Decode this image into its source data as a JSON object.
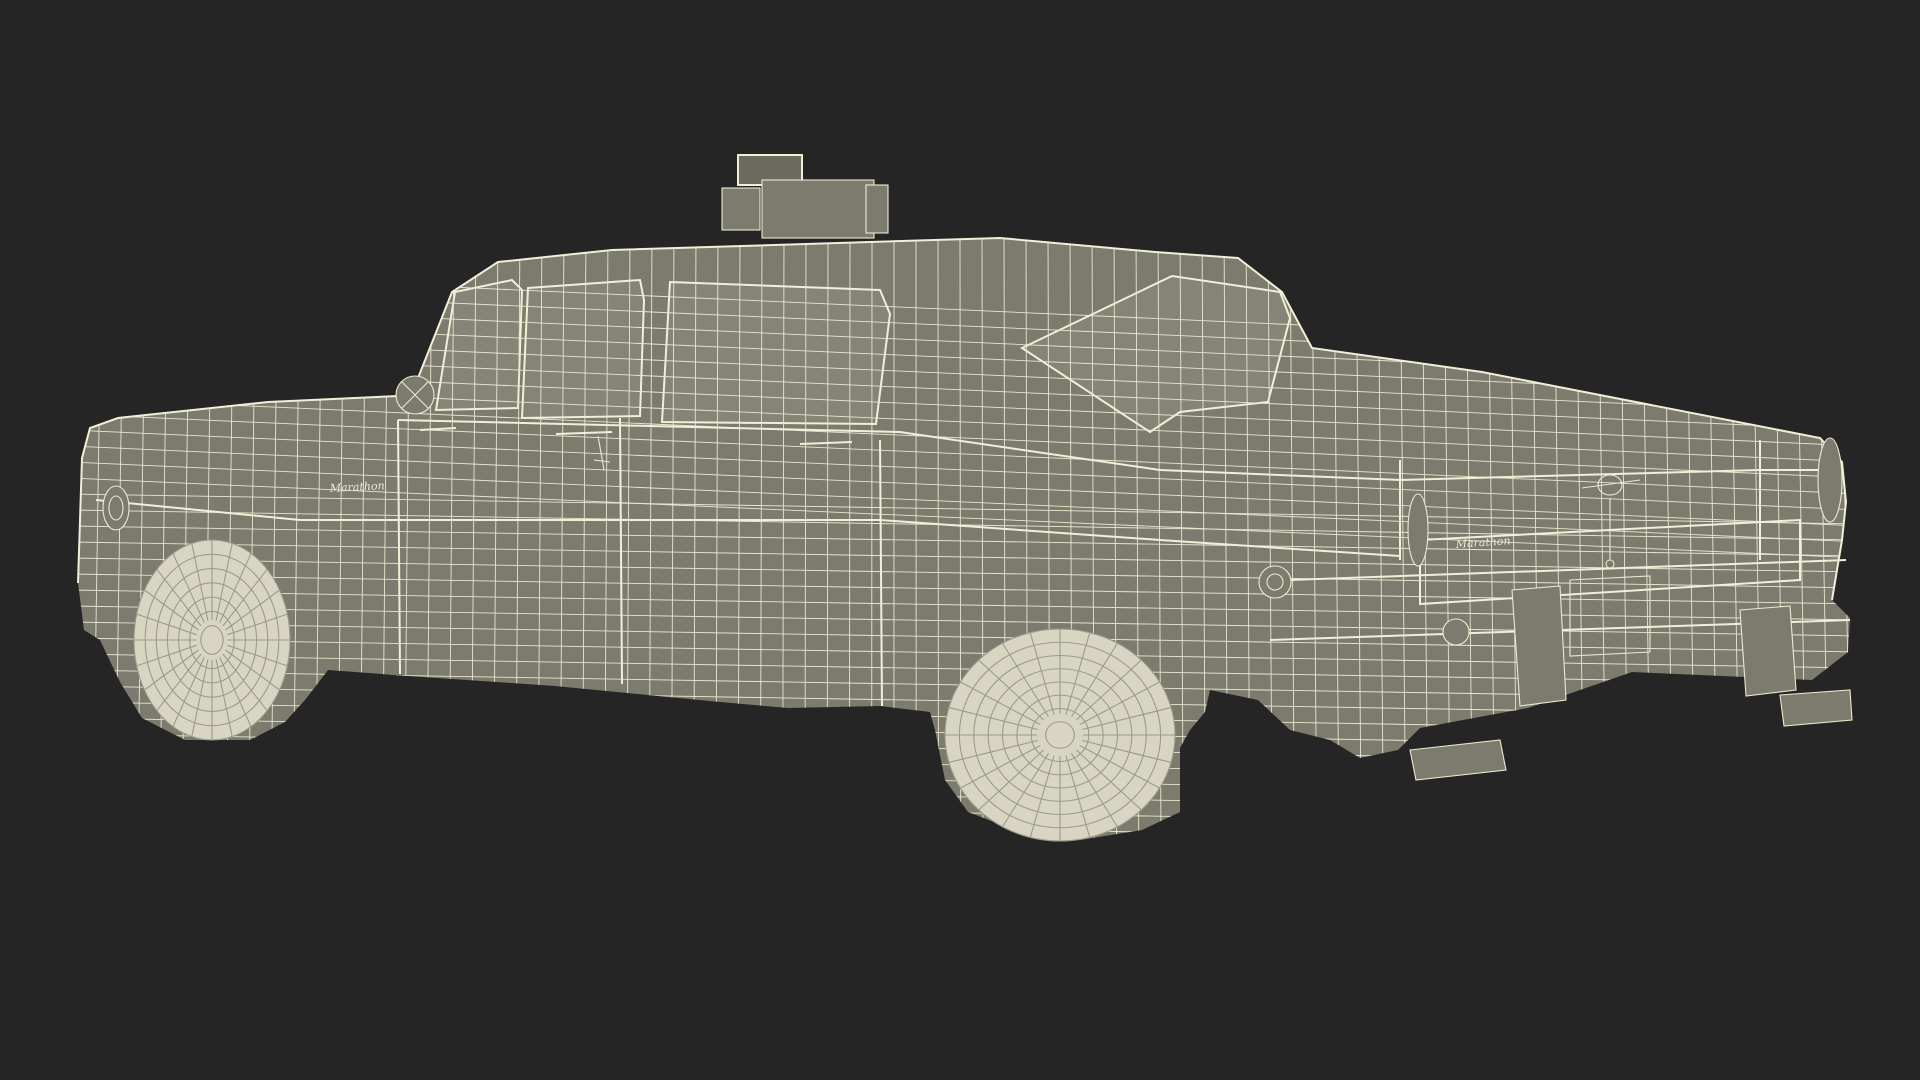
{
  "scene": {
    "subject": "wireframe-taxi-car",
    "background_color": "#252525",
    "body_color": "#7c7b6e",
    "wire_color": "#ece9d2"
  },
  "badges": {
    "side_badge_text": "Marathon",
    "rear_badge_text": "Marathon"
  }
}
